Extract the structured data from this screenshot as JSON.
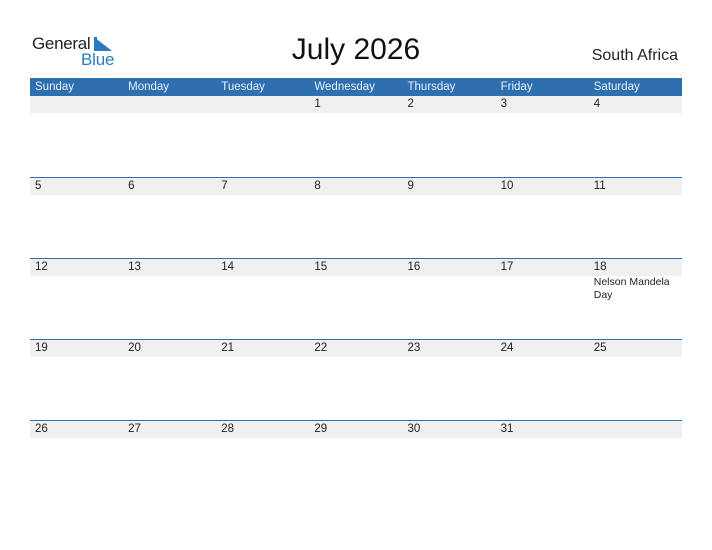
{
  "logo": {
    "line1": "General",
    "line2": "Blue"
  },
  "title": "July 2026",
  "country": "South Africa",
  "colors": {
    "accent": "#2e6fb0",
    "band": "#f0f0f0",
    "logo_blue": "#2a7bc0"
  },
  "weekdays": [
    "Sunday",
    "Monday",
    "Tuesday",
    "Wednesday",
    "Thursday",
    "Friday",
    "Saturday"
  ],
  "weeks": [
    [
      {
        "day": ""
      },
      {
        "day": ""
      },
      {
        "day": ""
      },
      {
        "day": "1"
      },
      {
        "day": "2"
      },
      {
        "day": "3"
      },
      {
        "day": "4"
      }
    ],
    [
      {
        "day": "5"
      },
      {
        "day": "6"
      },
      {
        "day": "7"
      },
      {
        "day": "8"
      },
      {
        "day": "9"
      },
      {
        "day": "10"
      },
      {
        "day": "11"
      }
    ],
    [
      {
        "day": "12"
      },
      {
        "day": "13"
      },
      {
        "day": "14"
      },
      {
        "day": "15"
      },
      {
        "day": "16"
      },
      {
        "day": "17"
      },
      {
        "day": "18",
        "event": "Nelson Mandela Day"
      }
    ],
    [
      {
        "day": "19"
      },
      {
        "day": "20"
      },
      {
        "day": "21"
      },
      {
        "day": "22"
      },
      {
        "day": "23"
      },
      {
        "day": "24"
      },
      {
        "day": "25"
      }
    ],
    [
      {
        "day": "26"
      },
      {
        "day": "27"
      },
      {
        "day": "28"
      },
      {
        "day": "29"
      },
      {
        "day": "30"
      },
      {
        "day": "31"
      },
      {
        "day": ""
      }
    ]
  ]
}
